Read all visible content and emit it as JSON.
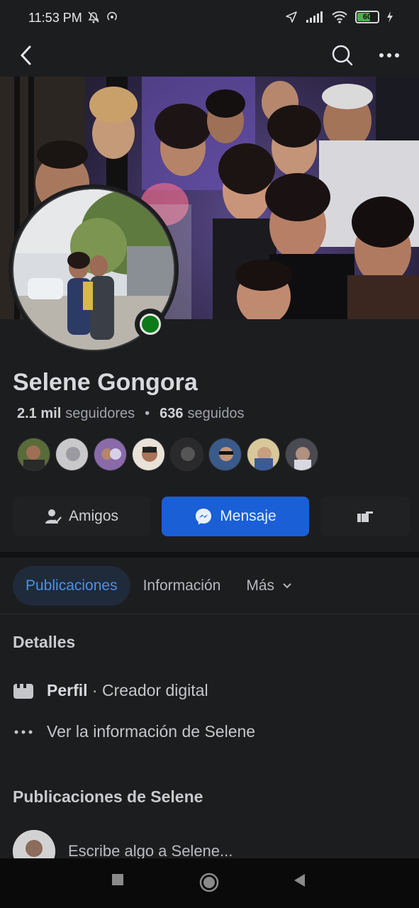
{
  "status_bar": {
    "time": "11:53 PM",
    "battery": "60"
  },
  "topbar": {
    "back_icon": "chevron-left-icon",
    "search_icon": "search-icon",
    "more_icon": "ellipsis-icon"
  },
  "profile": {
    "name": "Selene Gongora",
    "followers_count": "2.1 mil",
    "followers_label": "seguidores",
    "following_count": "636",
    "following_label": "seguidos",
    "online": true
  },
  "actions": {
    "friends_label": "Amigos",
    "message_label": "Mensaje"
  },
  "tabs": [
    {
      "label": "Publicaciones",
      "active": true
    },
    {
      "label": "Información",
      "active": false
    },
    {
      "label": "Más",
      "active": false
    }
  ],
  "details": {
    "title": "Detalles",
    "profile_label": "Perfil",
    "profile_value": "· Creador digital",
    "see_info": "Ver la información de Selene"
  },
  "posts": {
    "title": "Publicaciones de Selene",
    "composer_placeholder": "Escribe algo a Selene..."
  },
  "colors": {
    "background": "#1c1d1f",
    "accent": "#1a5fd6",
    "online": "#0d7a1a"
  }
}
